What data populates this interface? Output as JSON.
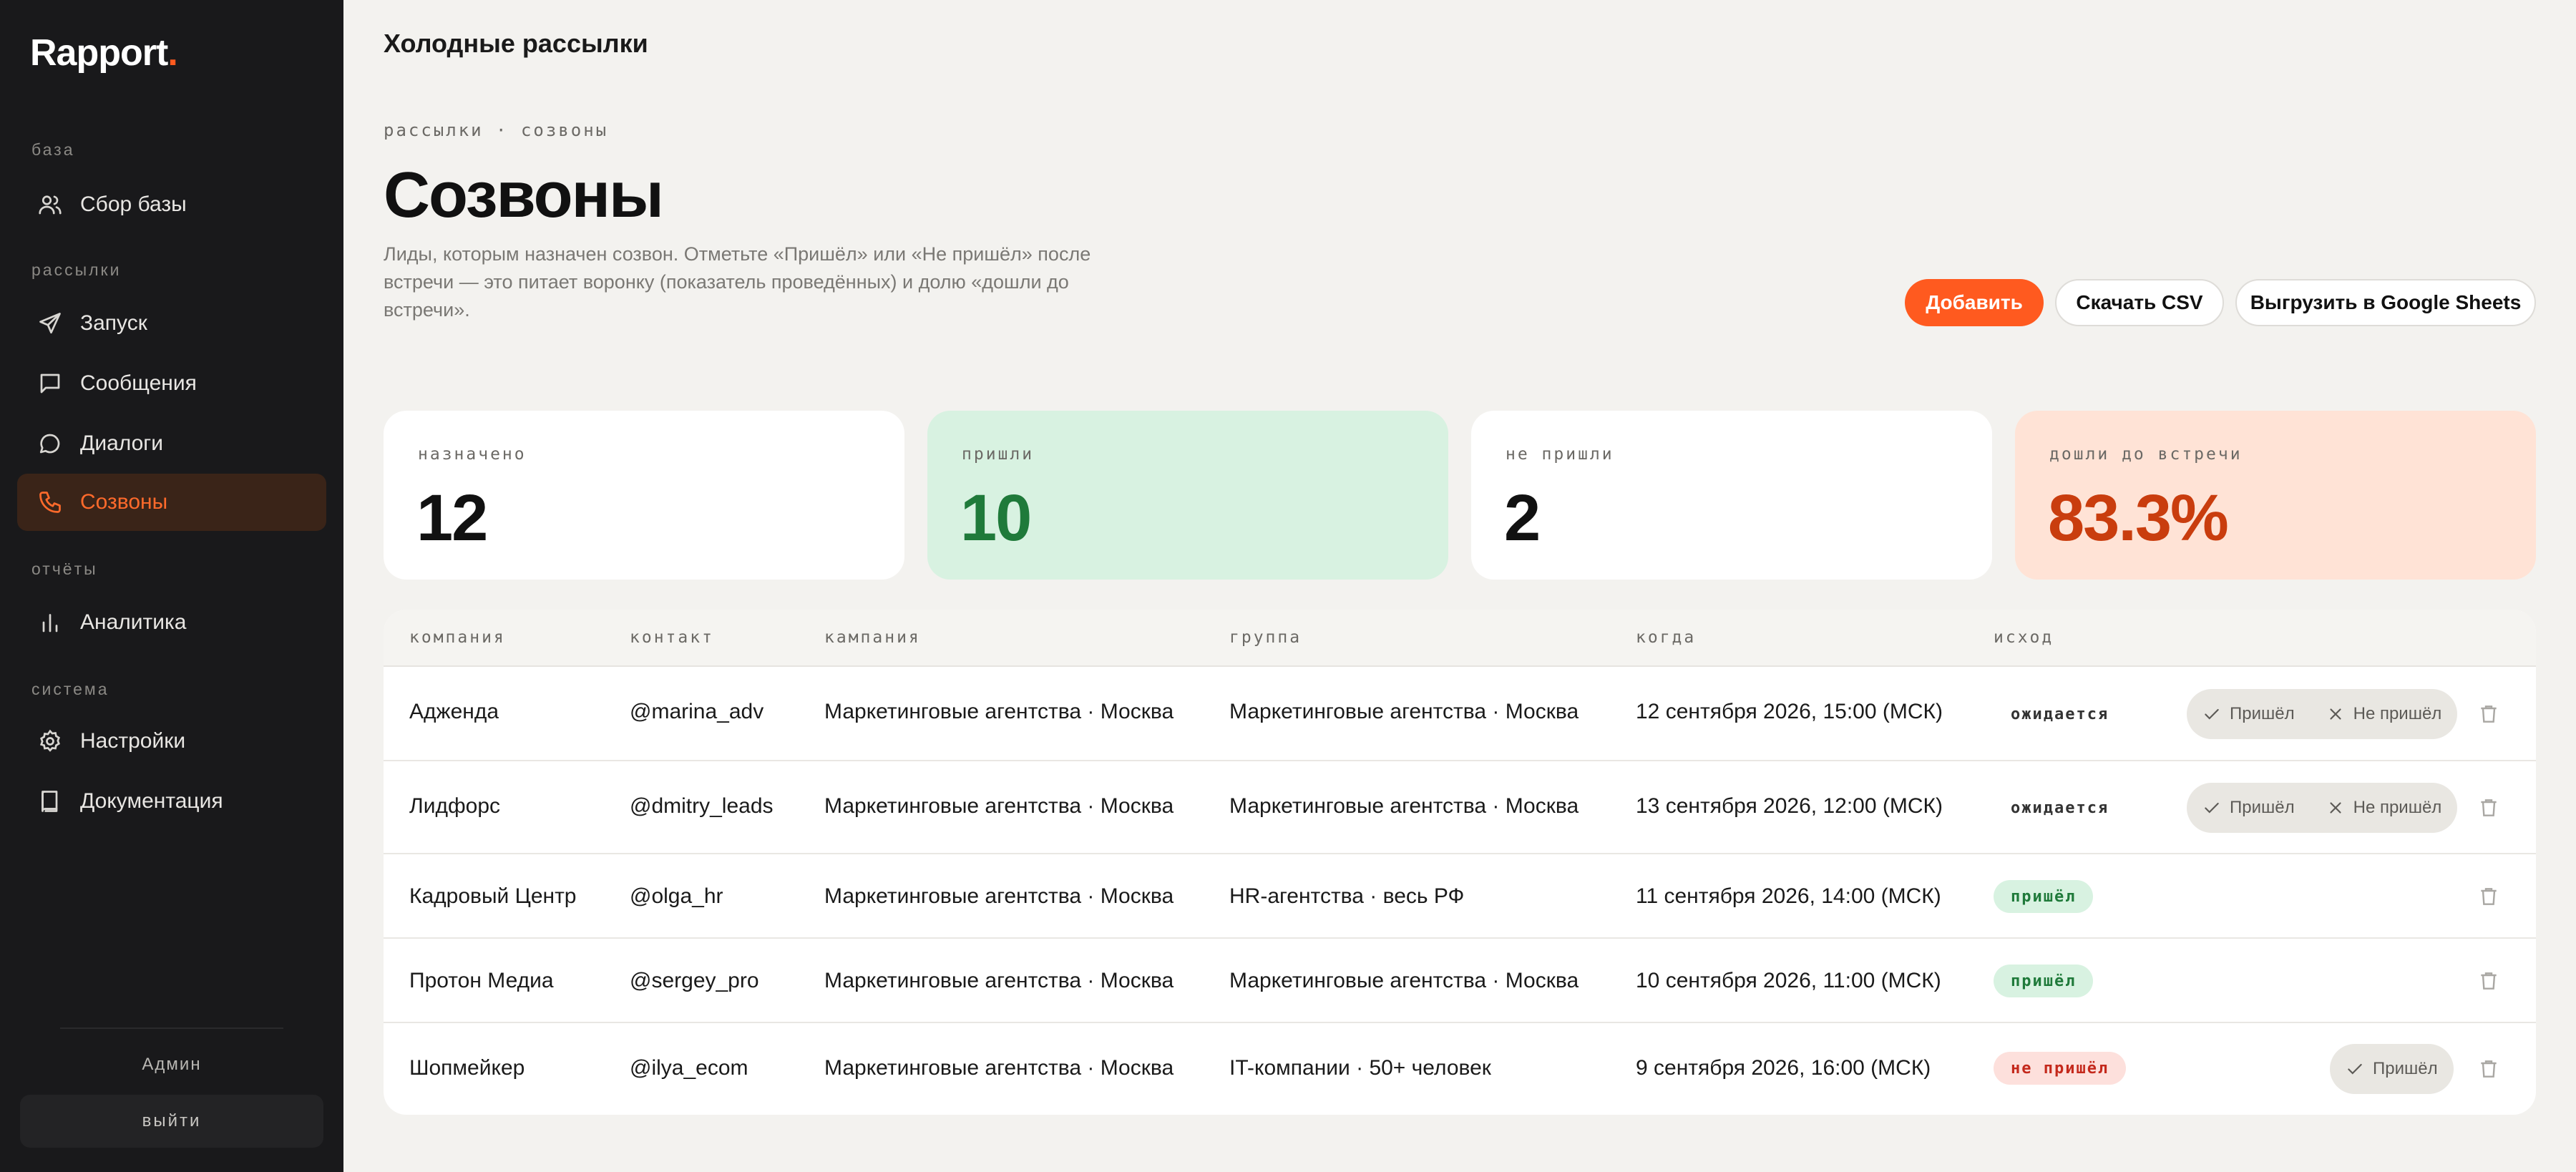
{
  "sidebar": {
    "logo": "Rapport",
    "logo_dot": ".",
    "sections": [
      {
        "label": "база",
        "items": [
          {
            "label": "Сбор базы",
            "icon": "users-icon"
          }
        ]
      },
      {
        "label": "рассылки",
        "items": [
          {
            "label": "Запуск",
            "icon": "send-icon"
          },
          {
            "label": "Сообщения",
            "icon": "message-square-icon"
          },
          {
            "label": "Диалоги",
            "icon": "chat-bubble-icon"
          },
          {
            "label": "Созвоны",
            "icon": "phone-icon",
            "active": true
          }
        ]
      },
      {
        "label": "отчёты",
        "items": [
          {
            "label": "Аналитика",
            "icon": "bar-chart-icon"
          }
        ]
      },
      {
        "label": "система",
        "items": [
          {
            "label": "Настройки",
            "icon": "gear-icon"
          },
          {
            "label": "Документация",
            "icon": "book-icon"
          }
        ]
      }
    ],
    "user": "Админ",
    "logout": "выйти"
  },
  "header": {
    "title": "Холодные рассылки",
    "breadcrumb": "рассылки · созвоны",
    "page_title": "Созвоны",
    "description": "Лиды, которым назначен созвон. Отметьте «Пришёл» или «Не пришёл» после встречи — это питает воронку (показатель проведённых) и долю «дошли до встречи»."
  },
  "actions": {
    "add": "Добавить",
    "csv": "Скачать CSV",
    "gsheets": "Выгрузить в Google Sheets"
  },
  "stats": [
    {
      "label": "назначено",
      "value": "12"
    },
    {
      "label": "пришли",
      "value": "10"
    },
    {
      "label": "не пришли",
      "value": "2"
    },
    {
      "label": "дошли до встречи",
      "value": "83.3%"
    }
  ],
  "table": {
    "columns": [
      "компания",
      "контакт",
      "кампания",
      "группа",
      "когда",
      "исход"
    ],
    "action_came": "Пришёл",
    "action_missed": "Не пришёл",
    "rows": [
      {
        "company": "Адженда",
        "contact": "@marina_adv",
        "campaign": "Маркетинговые агентства · Москва",
        "group": "Маркетинговые агентства · Москва",
        "when": "12 сентября 2026, 15:00 (МСК)",
        "outcome": "ожидается"
      },
      {
        "company": "Лидфорс",
        "contact": "@dmitry_leads",
        "campaign": "Маркетинговые агентства · Москва",
        "group": "Маркетинговые агентства · Москва",
        "when": "13 сентября 2026, 12:00 (МСК)",
        "outcome": "ожидается"
      },
      {
        "company": "Кадровый Центр",
        "contact": "@olga_hr",
        "campaign": "Маркетинговые агентства · Москва",
        "group": "HR-агентства · весь РФ",
        "when": "11 сентября 2026, 14:00 (МСК)",
        "outcome": "пришёл"
      },
      {
        "company": "Протон Медиа",
        "contact": "@sergey_pro",
        "campaign": "Маркетинговые агентства · Москва",
        "group": "Маркетинговые агентства · Москва",
        "when": "10 сентября 2026, 11:00 (МСК)",
        "outcome": "пришёл"
      },
      {
        "company": "Шопмейкер",
        "contact": "@ilya_ecom",
        "campaign": "Маркетинговые агентства · Москва",
        "group": "IT-компании · 50+ человек",
        "when": "9 сентября 2026, 16:00 (МСК)",
        "outcome": "не пришёл"
      }
    ]
  },
  "colors": {
    "accent": "#ff5a1f",
    "sidebar_bg": "#19191b",
    "success": "#1f7a3a",
    "danger": "#c4291c"
  }
}
